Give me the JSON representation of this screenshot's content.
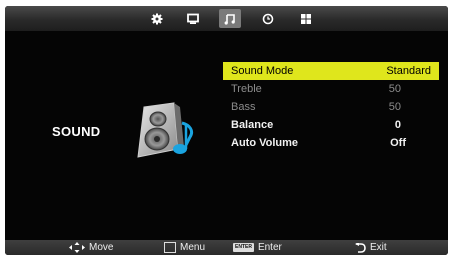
{
  "tabs": [
    {
      "name": "picture",
      "icon": "picture-gear-icon",
      "active": false
    },
    {
      "name": "screen",
      "icon": "monitor-icon",
      "active": false
    },
    {
      "name": "sound",
      "icon": "music-note-icon",
      "active": true
    },
    {
      "name": "time",
      "icon": "clock-icon",
      "active": false
    },
    {
      "name": "setup",
      "icon": "grid-icon",
      "active": false
    }
  ],
  "section": {
    "title": "SOUND",
    "icon": "speaker-icon"
  },
  "menu": [
    {
      "label": "Sound Mode",
      "value": "Standard",
      "state": "selected"
    },
    {
      "label": "Treble",
      "value": "50",
      "state": "disabled"
    },
    {
      "label": "Bass",
      "value": "50",
      "state": "disabled"
    },
    {
      "label": "Balance",
      "value": "0",
      "state": "normal"
    },
    {
      "label": "Auto Volume",
      "value": "Off",
      "state": "normal"
    }
  ],
  "footer": {
    "move": "Move",
    "menu": "Menu",
    "enter_key": "ENTER",
    "enter": "Enter",
    "exit": "Exit"
  },
  "colors": {
    "highlight": "#dfe61c",
    "background": "#050505",
    "disabled_text": "#8c8c8c"
  }
}
